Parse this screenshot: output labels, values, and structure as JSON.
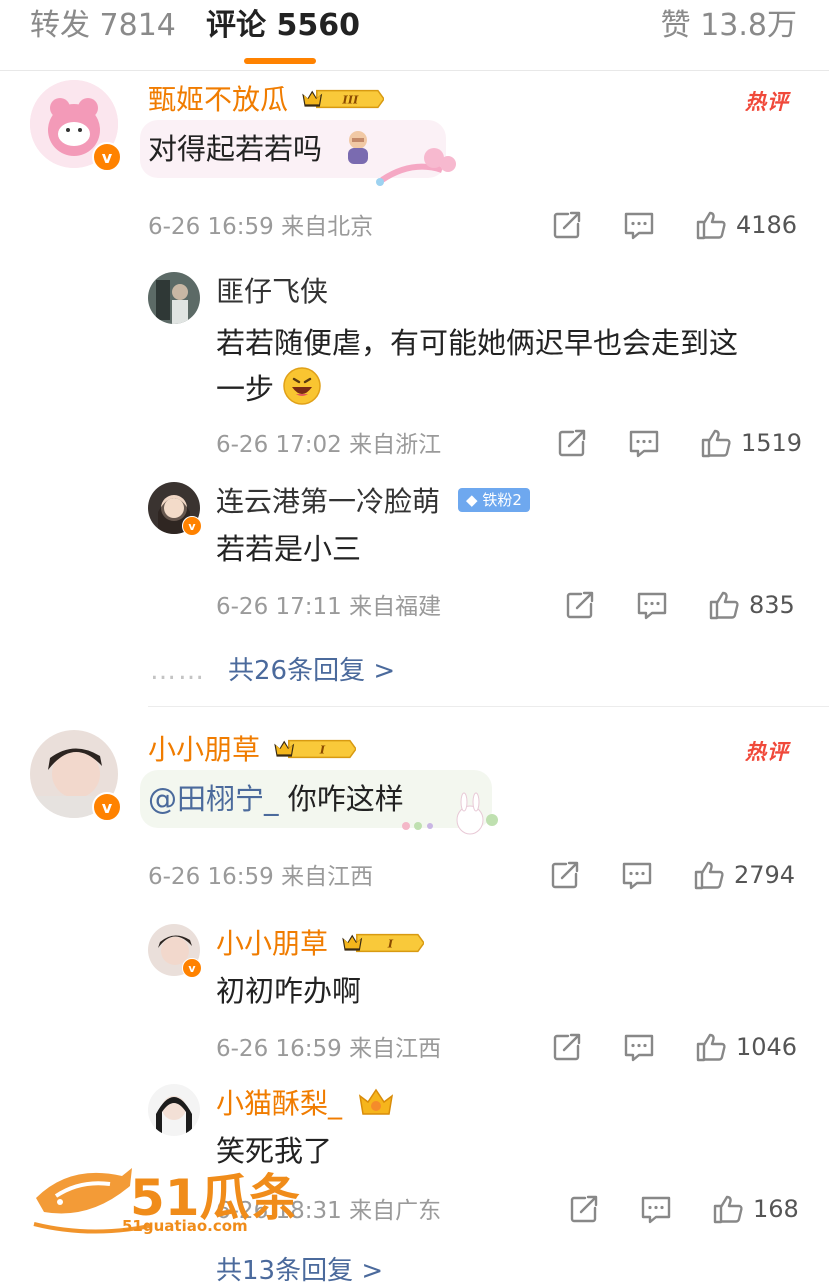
{
  "tabs": {
    "repost": "转发 7814",
    "comment": "评论 5560",
    "like": "赞 13.8万"
  },
  "hot_label": "热评",
  "comments": [
    {
      "user": "甄姬不放瓜",
      "badge": "III",
      "text": "对得起若若吗",
      "meta": "6-26 16:59 来自北京",
      "likes": "4186",
      "replies": [
        {
          "user": "匪仔飞侠",
          "text_line1": "若若随便虐，有可能她俩迟早也会走到这",
          "text_line2": "一步",
          "meta": "6-26 17:02 来自浙江",
          "likes": "1519"
        },
        {
          "user": "连云港第一冷脸萌",
          "fan_badge": "铁粉2",
          "text": "若若是小三",
          "meta": "6-26 17:11 来自福建",
          "likes": "835"
        }
      ],
      "more_replies": "共26条回复 >"
    },
    {
      "user": "小小朋草",
      "badge": "I",
      "mention": "@田栩宁_",
      "text": " 你咋这样",
      "meta": "6-26 16:59 来自江西",
      "likes": "2794",
      "replies": [
        {
          "user": "小小朋草",
          "badge": "I",
          "text": "初初咋办啊",
          "meta": "6-26 16:59 来自江西",
          "likes": "1046"
        },
        {
          "user": "小猫酥梨_",
          "text": "笑死我了",
          "meta": "6-26 18:31 来自广东",
          "likes": "168"
        }
      ],
      "more_replies": "共13条回复 >"
    }
  ],
  "more_dots": "……",
  "watermark": {
    "brand": "51瓜条",
    "url": "51guatiao.com"
  },
  "colors": {
    "accent": "#ff8200",
    "username": "#f07c00",
    "link": "#4b6a9c",
    "hot": "#f0493a"
  }
}
